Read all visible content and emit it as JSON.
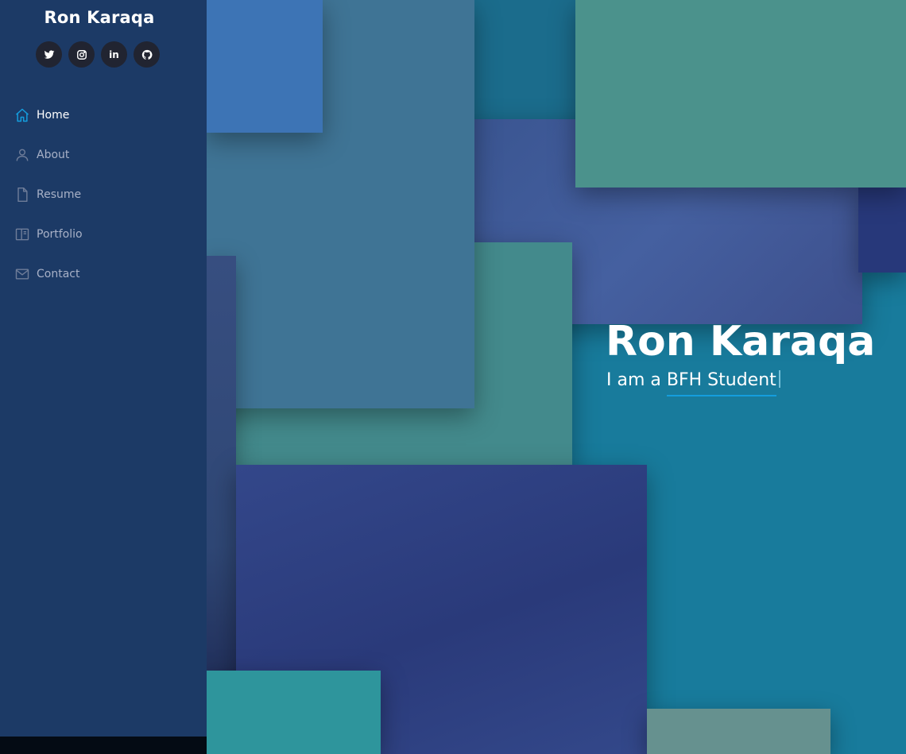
{
  "brand": {
    "name": "Ron Karaqa"
  },
  "social": [
    {
      "icon": "twitter-icon"
    },
    {
      "icon": "instagram-icon"
    },
    {
      "icon": "linkedin-icon",
      "glyph": "in"
    },
    {
      "icon": "github-icon"
    }
  ],
  "nav": [
    {
      "label": "Home",
      "icon": "home-icon",
      "active": true
    },
    {
      "label": "About",
      "icon": "person-icon",
      "active": false
    },
    {
      "label": "Resume",
      "icon": "file-icon",
      "active": false
    },
    {
      "label": "Portfolio",
      "icon": "book-icon",
      "active": false
    },
    {
      "label": "Contact",
      "icon": "envelope-icon",
      "active": false
    }
  ],
  "hero": {
    "name": "Ron Karaqa",
    "subtitle_prefix": "I am a ",
    "subtitle_typed": "BFH Student"
  },
  "colors": {
    "sidebar_bg": "#1c3a66",
    "accent": "#149ddd",
    "nav_text": "#a8b1c7",
    "nav_active_text": "#ffffff",
    "social_bg": "#212431"
  }
}
